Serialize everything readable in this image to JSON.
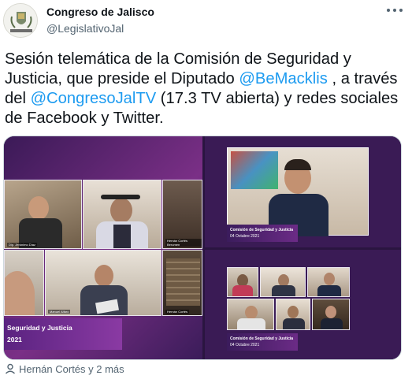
{
  "author": {
    "name": "Congreso de Jalisco",
    "handle": "@LegislativoJal",
    "avatar_alt": "escudo-icon"
  },
  "tweet": {
    "segments": [
      {
        "text": "Sesión telemática de la Comisión de Seguridad y Justicia, que preside el Diputado ",
        "type": "text"
      },
      {
        "text": "@BeMacklis",
        "type": "mention"
      },
      {
        "text": " , a través del ",
        "type": "text"
      },
      {
        "text": "@CongresoJalTV",
        "type": "mention"
      },
      {
        "text": " (17.3 TV abierta) y redes sociales de Facebook y Twitter.",
        "type": "text"
      }
    ]
  },
  "media": {
    "photo1": {
      "participants": [
        "Dip. Jerónimo Díaz",
        "Hernán Cortés Berumen",
        "Manuel Alfaro",
        "Hernán Cortés"
      ],
      "banner_title": "Seguridad y Justicia",
      "banner_date": "2021"
    },
    "photo2": {
      "banner_title": "Comisión de Seguridad y Justicia",
      "banner_date": "04 Octubre 2021"
    },
    "photo3": {
      "banner_title": "Comisión de Seguridad y Justicia",
      "banner_date": "04 Octubre 2021"
    }
  },
  "footer": {
    "liked_by": "Hernán Cortés y 2 más"
  },
  "colors": {
    "link": "#1d9bf0",
    "secondary": "#536471",
    "text": "#0f1419",
    "brand_purple": "#6b2b86"
  }
}
